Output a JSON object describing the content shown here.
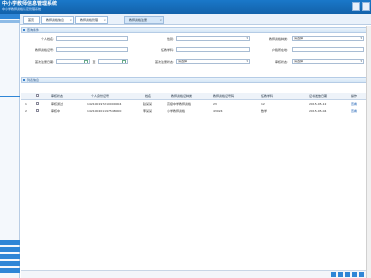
{
  "header": {
    "title": "中小学教师信息管理系统",
    "subtitle": "中小学教师资格认定管理系统"
  },
  "tabs": [
    {
      "label": "首页"
    },
    {
      "label": "教师资格信息"
    },
    {
      "label": "教师资格管理"
    },
    {
      "label": "教师资格注册"
    }
  ],
  "query_panel": {
    "title": "查询条件",
    "fields": {
      "name_label": "个人姓名:",
      "gender_label": "性别:",
      "gender_value": "",
      "cert_type_label": "教师资格种类:",
      "cert_type_value": "请选择",
      "cert_no_label": "教师资格证号:",
      "subject_label": "任教学科:",
      "origin_label": "户籍所在地:",
      "reg_date_label": "首次注册日期:",
      "reg_date_to": "至",
      "reg_status_label": "首次注册状态:",
      "reg_status_value": "请选择",
      "review_label": "审核状态:",
      "review_value": "请选择"
    }
  },
  "list_panel": {
    "title": "列表信息",
    "columns": [
      "审核状态",
      "个人身份证号",
      "姓名",
      "教师资格证种类",
      "教师资格证号码",
      "任教学科",
      "证书发放日期",
      "操作"
    ],
    "rows": [
      {
        "status": "审核通过",
        "id": "142100197210000004",
        "name": "赵某某",
        "type": "高级中学教师资格",
        "number": "23",
        "subject": "12",
        "date": "2015-05-12",
        "op": "查看"
      },
      {
        "status": "审核中",
        "id": "142100201197548000",
        "name": "李某某",
        "type": "小学教师资格",
        "number": "43024",
        "subject": "数学",
        "date": "2015-05-04",
        "op": "查看"
      }
    ]
  },
  "colors": {
    "header_bg": "#1668b8",
    "accent": "#2f86d6"
  }
}
